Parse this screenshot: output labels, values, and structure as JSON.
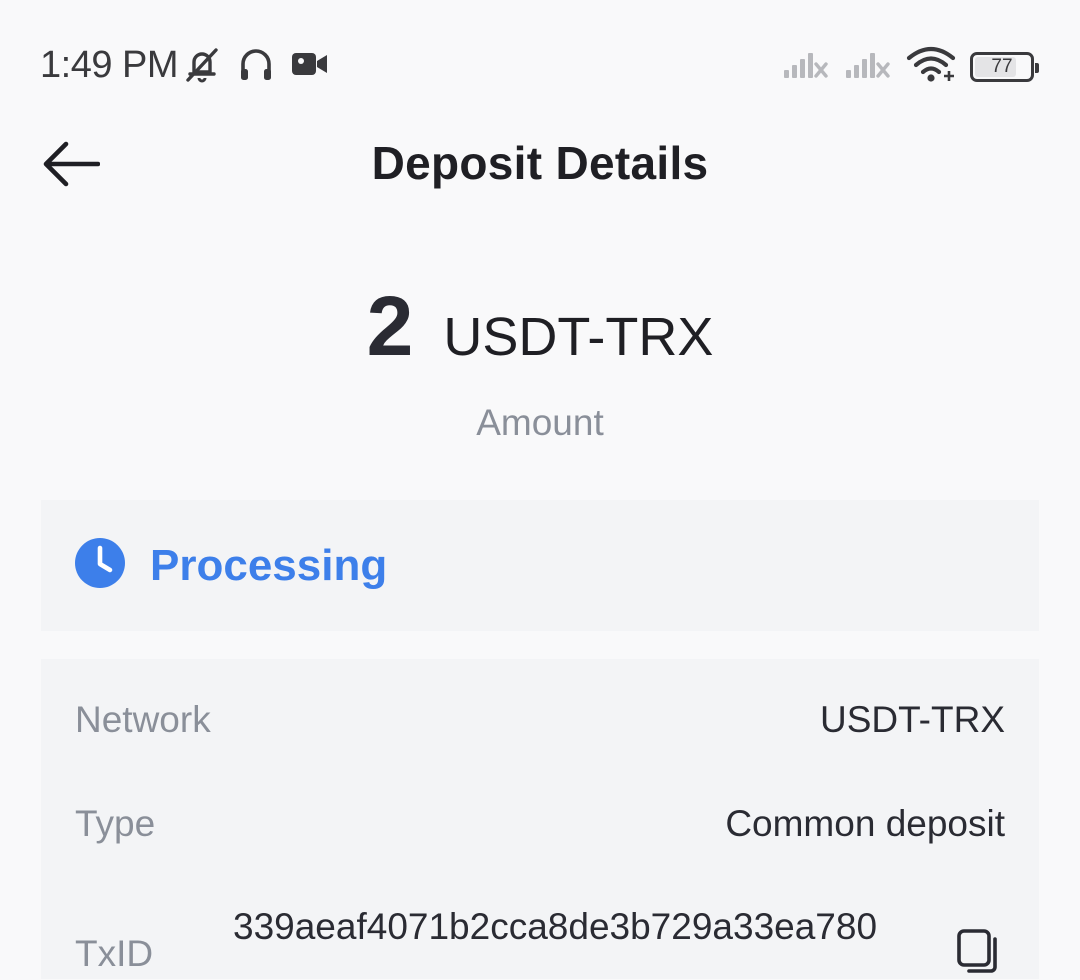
{
  "status_bar": {
    "time": "1:49 PM",
    "left_icons": [
      "bell-muted-icon",
      "headphones-icon",
      "video-camera-icon"
    ],
    "right_icons": [
      "signal-no-service-icon",
      "signal-no-service-icon",
      "wifi-icon"
    ],
    "battery_percent": 77,
    "battery_label": "77"
  },
  "header": {
    "title": "Deposit Details",
    "back_icon": "arrow-left-icon"
  },
  "amount": {
    "value": "2",
    "unit": "USDT-TRX",
    "label": "Amount"
  },
  "status": {
    "icon": "clock-icon",
    "text": "Processing",
    "color": "#3d7fea"
  },
  "details": {
    "network_label": "Network",
    "network_value": "USDT-TRX",
    "type_label": "Type",
    "type_value": "Common deposit",
    "txid_label": "TxID",
    "txid_value": "339aeaf4071b2cca8de3b729a33ea780",
    "copy_icon": "copy-icon"
  },
  "colors": {
    "background": "#f9f9fa",
    "card": "#f3f4f6",
    "accent": "#3d7fea",
    "muted_text": "#8a8f99",
    "primary_text": "#1f1f24"
  }
}
